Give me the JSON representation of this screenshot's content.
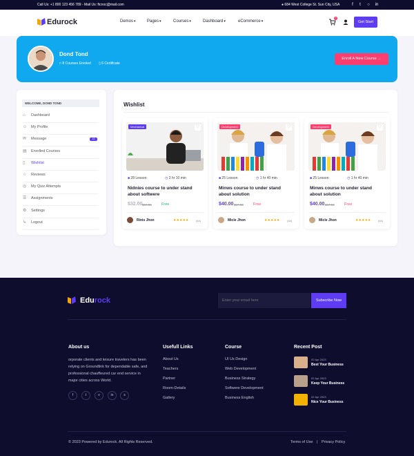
{
  "topbar": {
    "contact": "Call Us: +1 800 123 456 789 - Mail Us: ftcnoc@mail.com",
    "address": "684 West College St. Sun City, USA",
    "social_icons": [
      "facebook-icon",
      "twitter-icon",
      "instagram-icon",
      "linkedin-icon"
    ]
  },
  "brand": {
    "name_part1": "Edu",
    "name_part2": "rock",
    "accent": "#5d3cf2",
    "pink": "#ff3d6e",
    "blue": "#10a9f0"
  },
  "nav": {
    "items": [
      "Demos",
      "Pages",
      "Courses",
      "Dashboard",
      "eCommerce"
    ],
    "cart_count": "0",
    "get_start": "Get Start"
  },
  "profile": {
    "name": "Dond Tond",
    "courses_enrolled": "8 Courses Enroled",
    "certificates": "6 Certificate",
    "enroll_button": "Enroll A New Course"
  },
  "sidebar": {
    "welcome": "Welcome, Dond Tond",
    "items": [
      {
        "label": "Dashboard",
        "icon": "home-icon"
      },
      {
        "label": "My Profile",
        "icon": "user-icon"
      },
      {
        "label": "Message",
        "icon": "mail-icon",
        "badge": "12"
      },
      {
        "label": "Enrolled Courses",
        "icon": "book-icon"
      },
      {
        "label": "Wishlist",
        "icon": "bookmark-icon"
      },
      {
        "label": "Reviews",
        "icon": "star-icon"
      },
      {
        "label": "My Quiz Attempts",
        "icon": "quiz-icon"
      },
      {
        "label": "Assignments",
        "icon": "assignment-icon"
      },
      {
        "label": "Settings",
        "icon": "settings-icon"
      },
      {
        "label": "Logout",
        "icon": "logout-icon"
      }
    ]
  },
  "wishlist": {
    "title": "Wishlist",
    "cards": [
      {
        "tag": "Mechanical",
        "lessons": "28 Lesson",
        "duration": "2 hr 10 min",
        "title": "Nidnies course to under stand about softwere",
        "price": "$32.00",
        "old_price": "$67.00",
        "free": "Free",
        "author": "Rinis Jhon",
        "rating": "(44)"
      },
      {
        "tag": "Development",
        "lessons": "25 Lesson",
        "duration": "1 hr 40 min",
        "title": "Minws course to under stand about solution",
        "price": "$40.00",
        "old_price": "$67.00",
        "free": "Free",
        "author": "Micle Jhon",
        "rating": "(44)"
      },
      {
        "tag": "Development",
        "lessons": "25 Lesson",
        "duration": "1 hr 40 min",
        "title": "Minws course to under stand about solution",
        "price": "$40.00",
        "old_price": "$67.00",
        "free": "Free",
        "author": "Micle Jhon",
        "rating": "(44)"
      }
    ]
  },
  "footer": {
    "subscribe_placeholder": "Enter your email here",
    "subscribe_button": "Subscribe Now",
    "about_title": "About us",
    "about_text": "orporate clients and leisure travelers has been relying on Groundlink for dependable safe, and professional chauffeured car end service in major cities across World.",
    "links_title": "Usefull Links",
    "links": [
      "About Us",
      "Teachers",
      "Partner",
      "Room-Details",
      "Gallery"
    ],
    "course_title": "Course",
    "courses": [
      "UI Ux Design",
      "Web Development",
      "Business Strategy",
      "Softwere Development",
      "Business English"
    ],
    "recent_title": "Recent Post",
    "recent": [
      {
        "date": "02 Apr 2023",
        "title": "Best Your Business"
      },
      {
        "date": "02 Apr 2023",
        "title": "Keep Your Business"
      },
      {
        "date": "02 Apr 2023",
        "title": "Nice Your Business"
      }
    ],
    "copyright": "© 2023 Powered by Edurock. All Rights Reserved.",
    "terms": "Terms of Use",
    "privacy": "Privacy Policy"
  }
}
